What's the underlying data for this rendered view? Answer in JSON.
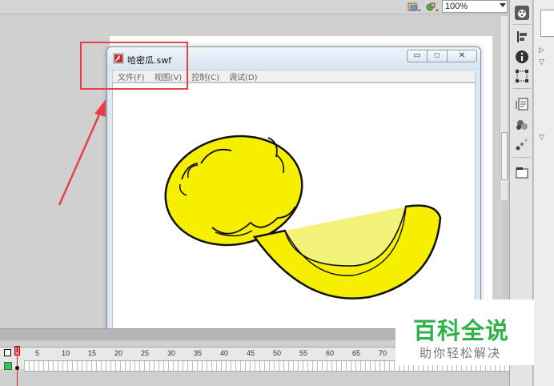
{
  "toolbar": {
    "zoom_value": "100%"
  },
  "swf_window": {
    "title": "哈密瓜.swf",
    "menu": [
      "文件(F)",
      "视图(V)",
      "控制(C)",
      "调试(D)"
    ],
    "min_glyph": "▭",
    "max_glyph": "□",
    "close_glyph": "✕"
  },
  "timeline": {
    "current_frame": "1",
    "ruler_numbers": [
      "5",
      "10",
      "15",
      "20",
      "25",
      "30",
      "35",
      "40",
      "45",
      "50",
      "55",
      "60",
      "65",
      "70"
    ]
  },
  "watermark": {
    "main": "百科全说",
    "sub": "助你轻松解决"
  },
  "colors": {
    "annotation_red": "#e8404a",
    "melon_yellow": "#f6f000",
    "watermark_green": "#2fb24a"
  }
}
